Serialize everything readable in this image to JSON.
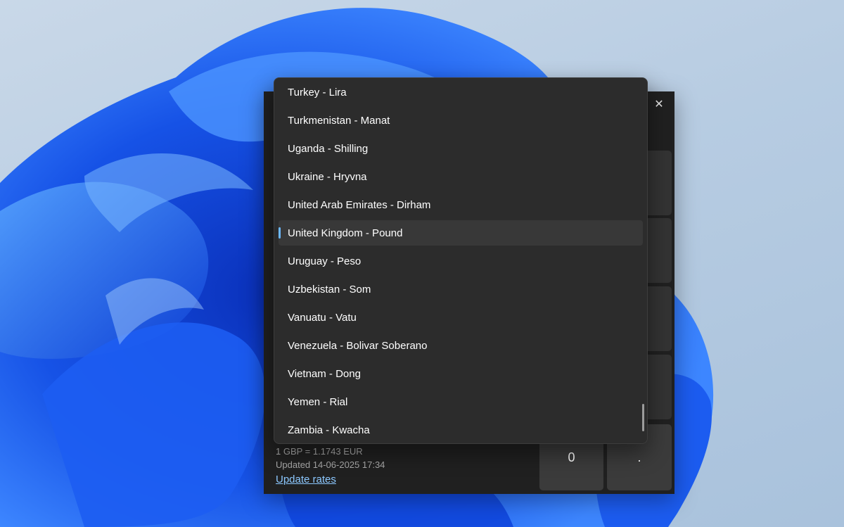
{
  "window": {
    "close_label": "✕"
  },
  "dropdown": {
    "options": [
      {
        "label": "Turkey - Lira"
      },
      {
        "label": "Turkmenistan - Manat"
      },
      {
        "label": "Uganda - Shilling"
      },
      {
        "label": "Ukraine - Hryvna"
      },
      {
        "label": "United Arab Emirates - Dirham"
      },
      {
        "label": "United Kingdom - Pound",
        "selected": true
      },
      {
        "label": "Uruguay - Peso"
      },
      {
        "label": "Uzbekistan - Som"
      },
      {
        "label": "Vanuatu - Vatu"
      },
      {
        "label": "Venezuela - Bolivar Soberano"
      },
      {
        "label": "Vietnam - Dong"
      },
      {
        "label": "Yemen - Rial"
      },
      {
        "label": "Zambia - Kwacha"
      }
    ]
  },
  "converter": {
    "rate": "1 GBP = 1.1743 EUR",
    "updated": "Updated 14-06-2025 17:34",
    "update_link": "Update rates"
  },
  "keypad": {
    "zero": "0",
    "decimal": "."
  },
  "colors": {
    "accent": "#6cb8ff",
    "link": "#8cc8ff",
    "wallpaper_blue": "#1a56e8"
  }
}
